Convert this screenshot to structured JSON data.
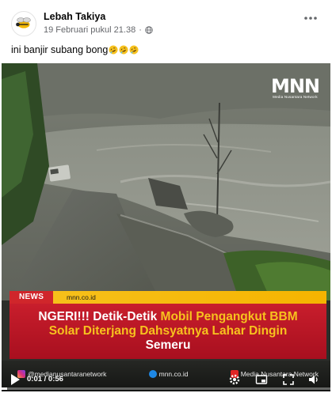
{
  "post": {
    "author": "Lebah Takiya",
    "date": "19 Februari pukul 21.38",
    "date_separator": "·",
    "caption_text": "ini banjir subang bong",
    "caption_emoji": [
      "rolling-on-floor-laughing",
      "rolling-on-floor-laughing",
      "rolling-on-floor-laughing"
    ]
  },
  "video": {
    "watermark_logo": "MNN",
    "watermark_sub": "Media Nusantara Network",
    "news_tag": "NEWS",
    "news_site": "mnn.co.id",
    "headline_white_1": "NGERI!!! Detik-Detik ",
    "headline_yellow_1": "Mobil Pengangkut BBM Solar Diterjang Dahsyatnya Lahar Dingin",
    "headline_white_2": " Semeru",
    "socials": [
      {
        "icon": "instagram-icon",
        "text": "@medianusantaranetwork"
      },
      {
        "icon": "web-icon",
        "text": "mnn.co.id"
      },
      {
        "icon": "youtube-icon",
        "text": "Media Nusantara Network"
      }
    ],
    "time_display": "0:01 / 0:56",
    "progress": 0.018,
    "colors": {
      "news_red": "#d0262b",
      "strip_yellow": "#f5b400",
      "headline_red": "#c81e2c",
      "highlight_yellow": "#f7c21e"
    }
  }
}
